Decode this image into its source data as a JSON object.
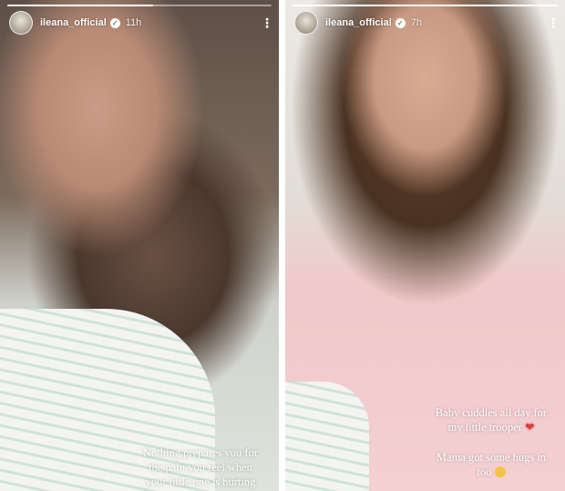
{
  "stories": [
    {
      "username": "ileana_official",
      "time": "11h",
      "progress": 0.55,
      "caption_lines": [
        "Nothing prepares you for",
        "the pain you feel when",
        "your little one is hurting"
      ]
    },
    {
      "username": "ileana_official",
      "time": "7h",
      "progress": 1.0,
      "caption1_lines": [
        "Baby cuddles all day for",
        "my little trooper"
      ],
      "caption1_emoji": "❤",
      "caption2_lines": [
        "Mama got some hugs in",
        "too"
      ],
      "caption2_emoji": "pleading-face"
    }
  ],
  "icons": {
    "verified": "✓",
    "more": "⋮"
  },
  "colors": {
    "left_shirt_stripe": "#cfe2d9",
    "right_robe": "#f4d0d2"
  }
}
